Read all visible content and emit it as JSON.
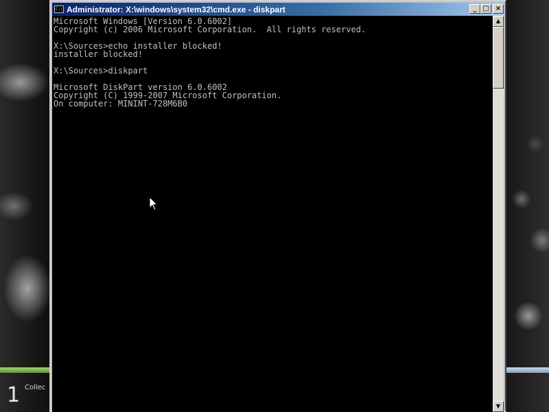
{
  "window": {
    "title": "Administrator: X:\\windows\\system32\\cmd.exe - diskpart",
    "icon_label": "C:\\",
    "buttons": {
      "minimize": "_",
      "maximize": "□",
      "close": "×"
    }
  },
  "console": {
    "lines": [
      "Microsoft Windows [Version 6.0.6002]",
      "Copyright (c) 2006 Microsoft Corporation.  All rights reserved.",
      "",
      "X:\\Sources>echo installer blocked!",
      "installer blocked!",
      "",
      "X:\\Sources>diskpart",
      "",
      "Microsoft DiskPart version 6.0.6002",
      "Copyright (C) 1999-2007 Microsoft Corporation.",
      "On computer: MININT-728M6B0"
    ],
    "text_color": "#c0c0c0",
    "background": "#000000"
  },
  "scrollbar": {
    "up_arrow": "▲",
    "down_arrow": "▼"
  },
  "desktop": {
    "gadget_number": "1",
    "gadget_text": "Collec"
  },
  "colors": {
    "titlebar_start": "#0a246a",
    "titlebar_end": "#a6caf0"
  }
}
